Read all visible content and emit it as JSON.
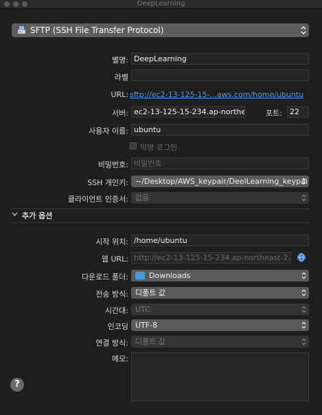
{
  "window": {
    "title": "DeepLearning"
  },
  "protocol": {
    "label": "SFTP (SSH File Transfer Protocol)"
  },
  "form": {
    "nickname_label": "별명:",
    "nickname_value": "DeepLearning",
    "tag_label": "라벨",
    "tag_value": "",
    "url_label": "URL:",
    "url_value": "sftp://ec2-13-125-15-...aws.com/home/ubuntu",
    "server_label": "서버:",
    "server_value": "ec2-13-125-15-234.ap-northea",
    "port_label": "포트:",
    "port_value": "22",
    "username_label": "사용자 이름:",
    "username_value": "ubuntu",
    "anonymous_label": "익명 로그인",
    "password_label": "비밀번호:",
    "password_placeholder": "비밀번호",
    "ssh_key_label": "SSH 개인키:",
    "ssh_key_value": "~/Desktop/AWS_keypair/DeelLearning_keypai",
    "client_cert_label": "클라이언트 인증서:",
    "client_cert_value": "없음"
  },
  "advanced": {
    "toggle_label": "추가 옵션",
    "start_dir_label": "시작 위치:",
    "start_dir_value": "/home/ubuntu",
    "web_url_label": "웹 URL:",
    "web_url_placeholder": "http://ec2-13-125-15-234.ap-northeast-2.c",
    "download_label": "다운로드 폴더:",
    "download_value": "Downloads",
    "transfer_label": "전송 방식:",
    "transfer_value": "디폴트 값",
    "timezone_label": "시간대:",
    "timezone_value": "UTC",
    "encoding_label": "인코딩",
    "encoding_value": "UTF-8",
    "connect_label": "연결 방식:",
    "connect_value": "디폴트 값",
    "notes_label": "메모:",
    "notes_value": ""
  },
  "help": {
    "label": "?"
  }
}
